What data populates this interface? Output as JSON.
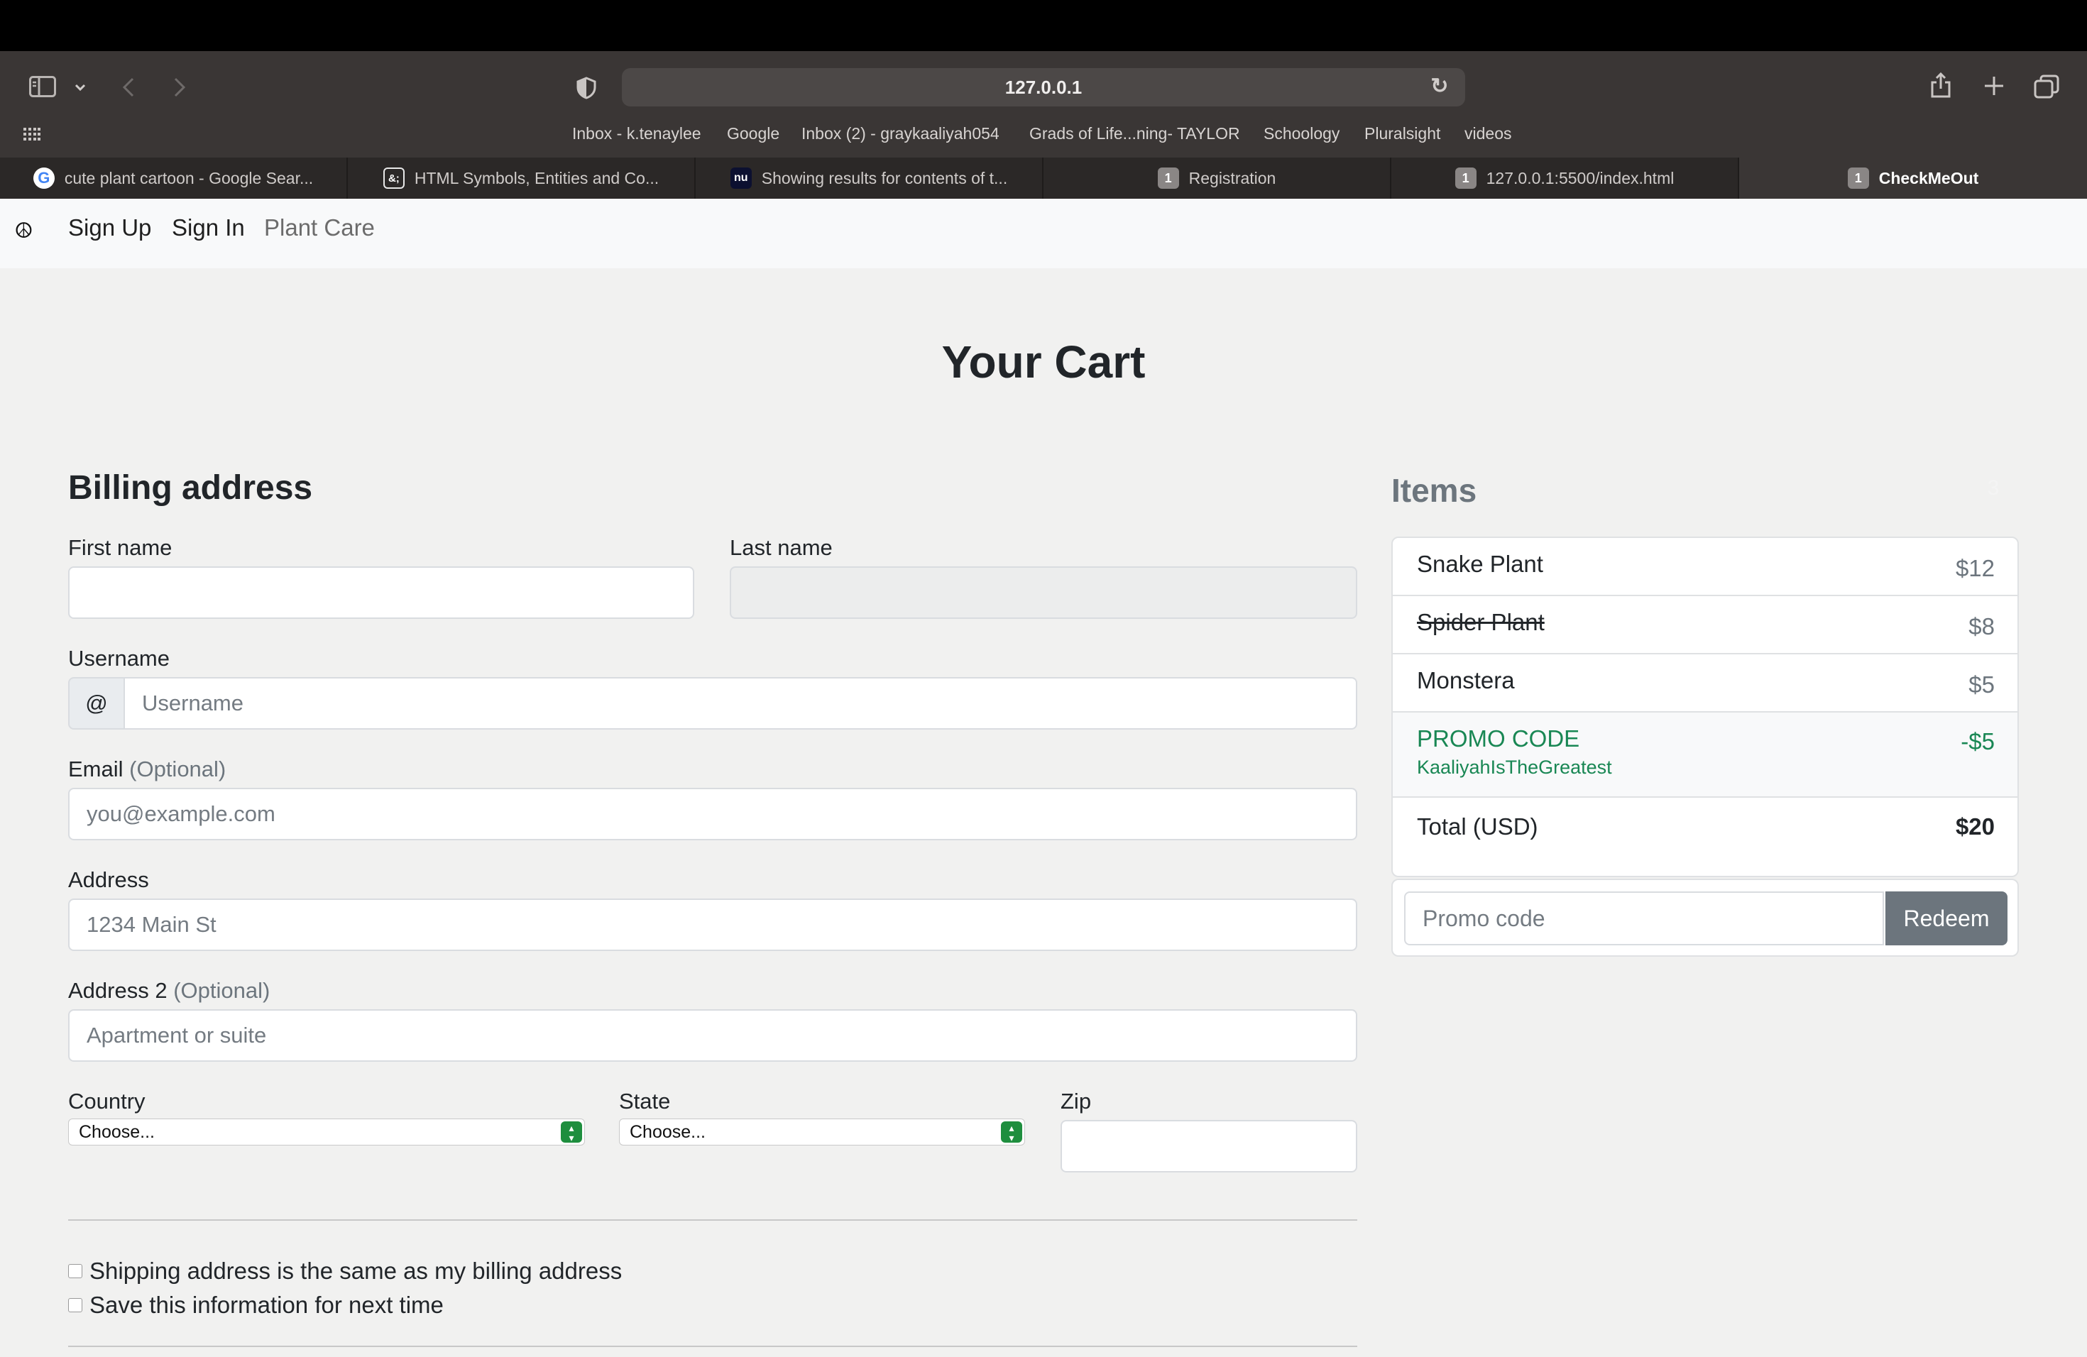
{
  "browser": {
    "url": "127.0.0.1",
    "favorites": [
      "Inbox - k.tenaylee",
      "Google",
      "Inbox (2) - graykaaliyah054",
      "Grads of Life...ning- TAYLOR",
      "Schoology",
      "Pluralsight",
      "videos"
    ],
    "tabs": [
      {
        "title": "cute plant cartoon - Google Sear...",
        "icon": "google-icon",
        "favicon_text": "G"
      },
      {
        "title": "HTML Symbols, Entities and Co...",
        "icon": "ampersand-icon",
        "favicon_text": "&;"
      },
      {
        "title": "Showing results for contents of t...",
        "icon": "nu-icon",
        "favicon_text": "nu"
      },
      {
        "title": "Registration",
        "icon": "number-badge-icon",
        "favicon_text": "1"
      },
      {
        "title": "127.0.0.1:5500/index.html",
        "icon": "number-badge-icon",
        "favicon_text": "1"
      },
      {
        "title": "CheckMeOut",
        "icon": "number-badge-icon",
        "favicon_text": "1",
        "active": true
      }
    ]
  },
  "nav": {
    "brand_icon": "peace-icon",
    "brand_glyph": "☮",
    "links": [
      "Sign Up",
      "Sign In",
      "Plant Care"
    ]
  },
  "page": {
    "title": "Your Cart"
  },
  "billing": {
    "title": "Billing address",
    "first_name": {
      "label": "First name",
      "value": "",
      "placeholder": ""
    },
    "last_name": {
      "label": "Last name",
      "value": "",
      "placeholder": ""
    },
    "username": {
      "label": "Username",
      "prefix": "@",
      "placeholder": "Username"
    },
    "email": {
      "label": "Email",
      "optional": "(Optional)",
      "placeholder": "you@example.com"
    },
    "address": {
      "label": "Address",
      "placeholder": "1234 Main St"
    },
    "address2": {
      "label": "Address 2",
      "optional": "(Optional)",
      "placeholder": "Apartment or suite"
    },
    "country": {
      "label": "Country",
      "selected": "Choose..."
    },
    "state": {
      "label": "State",
      "selected": "Choose..."
    },
    "zip": {
      "label": "Zip",
      "value": ""
    },
    "checks": [
      "Shipping address is the same as my billing address",
      "Save this information for next time"
    ]
  },
  "cart": {
    "title": "Items",
    "count": "3",
    "items": [
      {
        "name": "Snake Plant",
        "price": "$12"
      },
      {
        "name": "Spider Plant",
        "price": "$8",
        "struck": true
      },
      {
        "name": "Monstera",
        "price": "$5"
      }
    ],
    "promo": {
      "label": "PROMO CODE",
      "code": "KaaliyahIsTheGreatest",
      "amount": "-$5"
    },
    "total": {
      "label": "Total (USD)",
      "amount": "$20"
    },
    "redeem": {
      "placeholder": "Promo code",
      "button": "Redeem"
    }
  },
  "colors": {
    "promo_green": "#198754",
    "secondary_button": "#6c757d",
    "chrome_dark": "#3a3635"
  }
}
